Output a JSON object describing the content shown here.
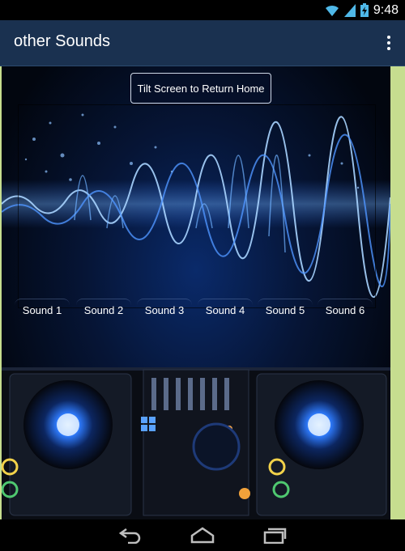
{
  "status_bar": {
    "time": "9:48",
    "icons": [
      "wifi-icon",
      "signal-icon",
      "battery-charging-icon"
    ]
  },
  "action_bar": {
    "title": "other Sounds",
    "overflow_icon": "overflow-menu-icon"
  },
  "main": {
    "tilt_button_label": "Tilt Screen to Return Home",
    "sound_buttons": [
      "Sound 1",
      "Sound 2",
      "Sound 3",
      "Sound 4",
      "Sound 5",
      "Sound 6"
    ],
    "background_image": "dj-turntables-sound-wave"
  },
  "nav_bar": {
    "icons": [
      "back-icon",
      "home-icon",
      "recent-apps-icon"
    ]
  },
  "colors": {
    "action_bar": "#1a3150",
    "side_accent": "#c6dd8f",
    "background": "#000000"
  }
}
